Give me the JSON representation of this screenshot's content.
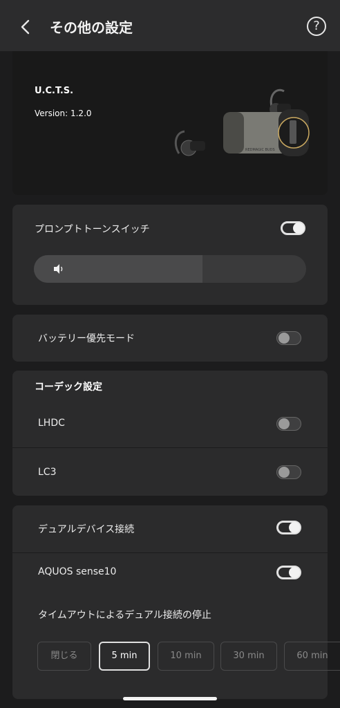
{
  "header": {
    "title": "その他の設定"
  },
  "device": {
    "name": "U.C.T.S.",
    "version": "Version: 1.2.0",
    "case_text": "REDMAGIC BUDS"
  },
  "prompt_tone": {
    "label": "プロンプトトーンスイッチ",
    "enabled": true,
    "volume_percent": 62
  },
  "battery_mode": {
    "label": "バッテリー優先モード",
    "enabled": false
  },
  "codec": {
    "title": "コーデック設定",
    "items": [
      {
        "label": "LHDC",
        "enabled": false
      },
      {
        "label": "LC3",
        "enabled": false
      }
    ]
  },
  "dual": {
    "label": "デュアルデバイス接続",
    "enabled": true,
    "device_label": "AQUOS sense10",
    "device_enabled": true,
    "timeout_title": "タイムアウトによるデュアル接続の停止",
    "options": [
      "閉じる",
      "5 min",
      "10 min",
      "30 min",
      "60 min"
    ],
    "selected": "5 min"
  },
  "colors": {
    "background": "#1c1c1d",
    "card": "#2b2b2c",
    "accent": "#e2e2e2"
  }
}
